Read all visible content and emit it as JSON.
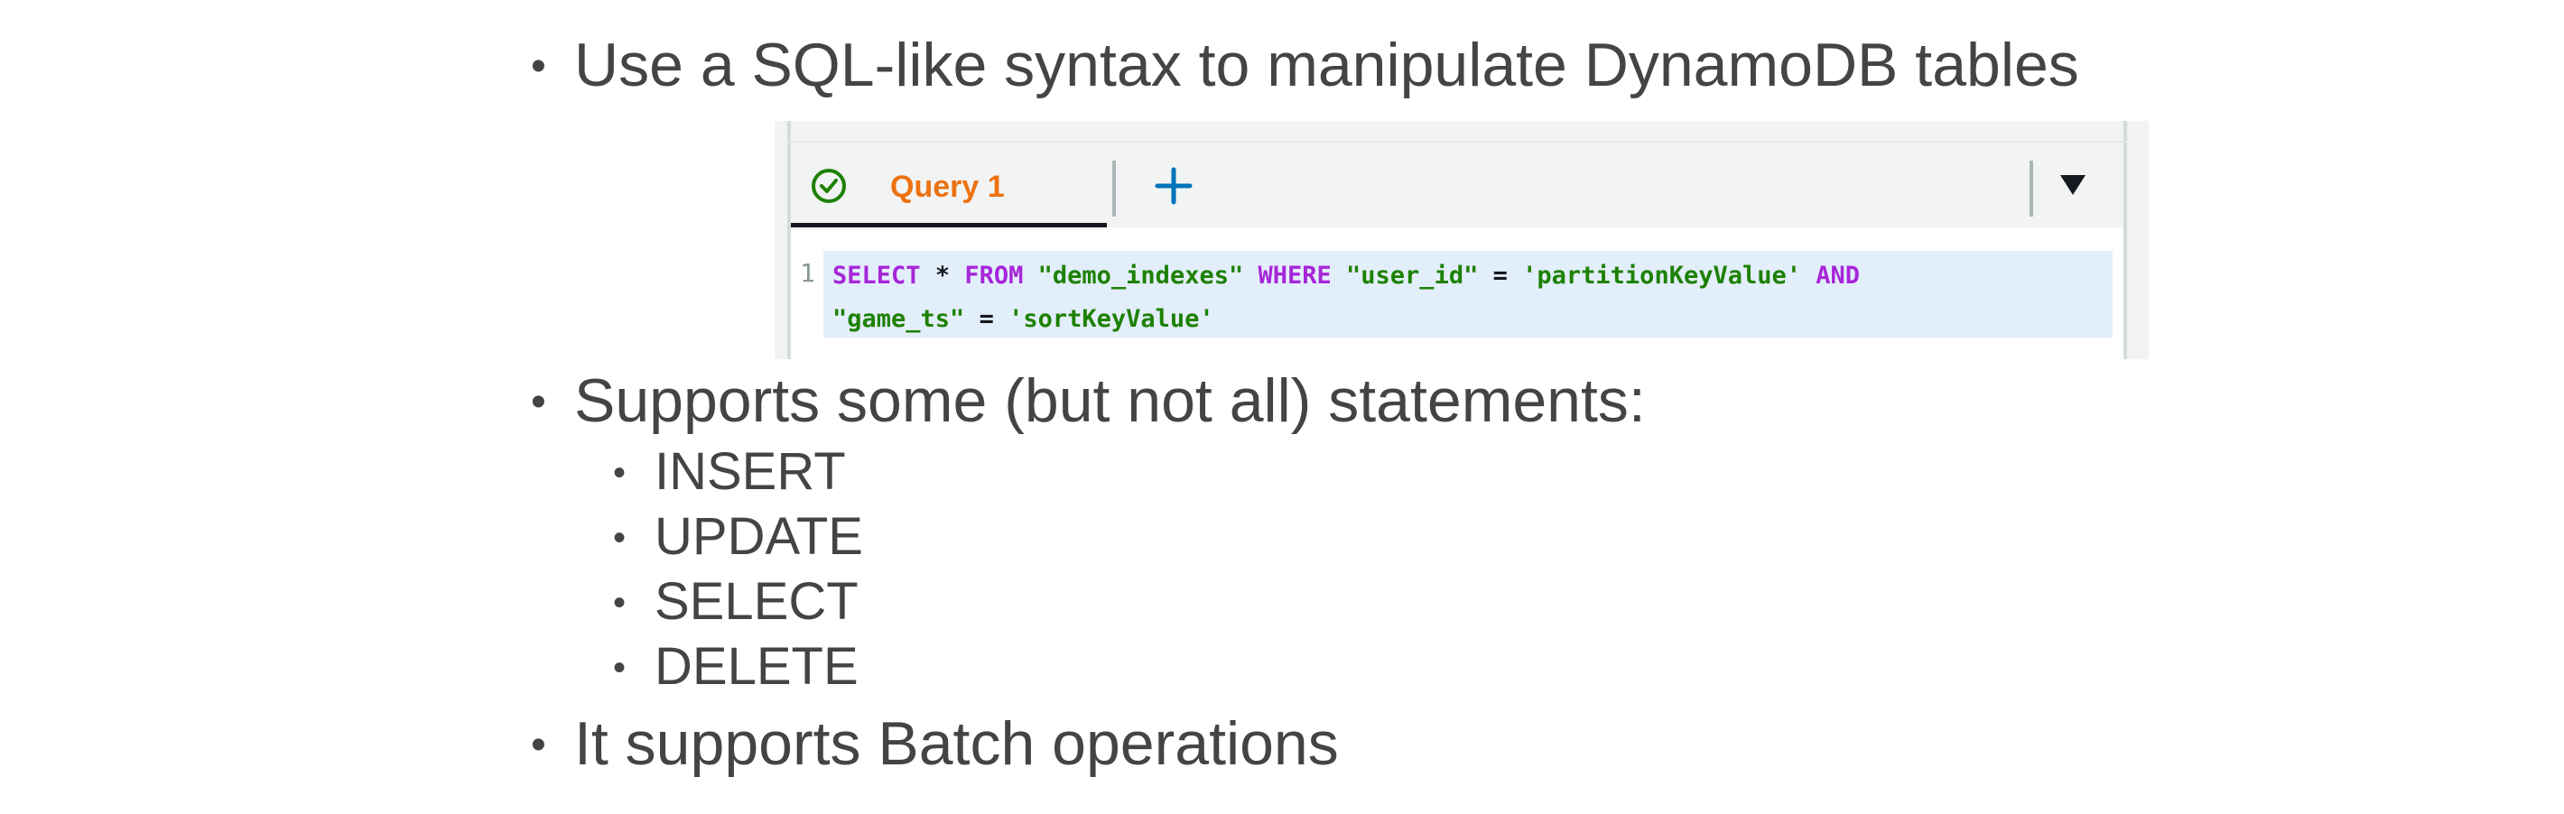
{
  "bullets": {
    "b1": "Use a SQL-like syntax to manipulate DynamoDB tables",
    "b2": "Supports some (but not all) statements:",
    "statements": [
      "INSERT",
      "UPDATE",
      "SELECT",
      "DELETE"
    ],
    "b3": "It supports Batch operations",
    "dot": "•"
  },
  "editor": {
    "tab_label": "Query 1",
    "tab_status_icon": "check-circle-icon",
    "add_tab_icon": "plus-icon",
    "menu_icon": "caret-down-icon",
    "line_numbers": [
      "1"
    ],
    "code": {
      "select": "SELECT",
      "star": "*",
      "from": "FROM",
      "table": "\"demo_indexes\"",
      "where": "WHERE",
      "pk_attr": "\"user_id\"",
      "eq1": "=",
      "pk_val": "'partitionKeyValue'",
      "and": "AND",
      "sk_attr": "\"game_ts\"",
      "eq2": "=",
      "sk_val": "'sortKeyValue'"
    },
    "colors": {
      "tab_label": "#ec7211",
      "status_icon": "#1d8102",
      "add_icon": "#0073bb",
      "keyword": "#a626d8",
      "string": "#1d8102",
      "highlight": "#e3eefb"
    }
  }
}
